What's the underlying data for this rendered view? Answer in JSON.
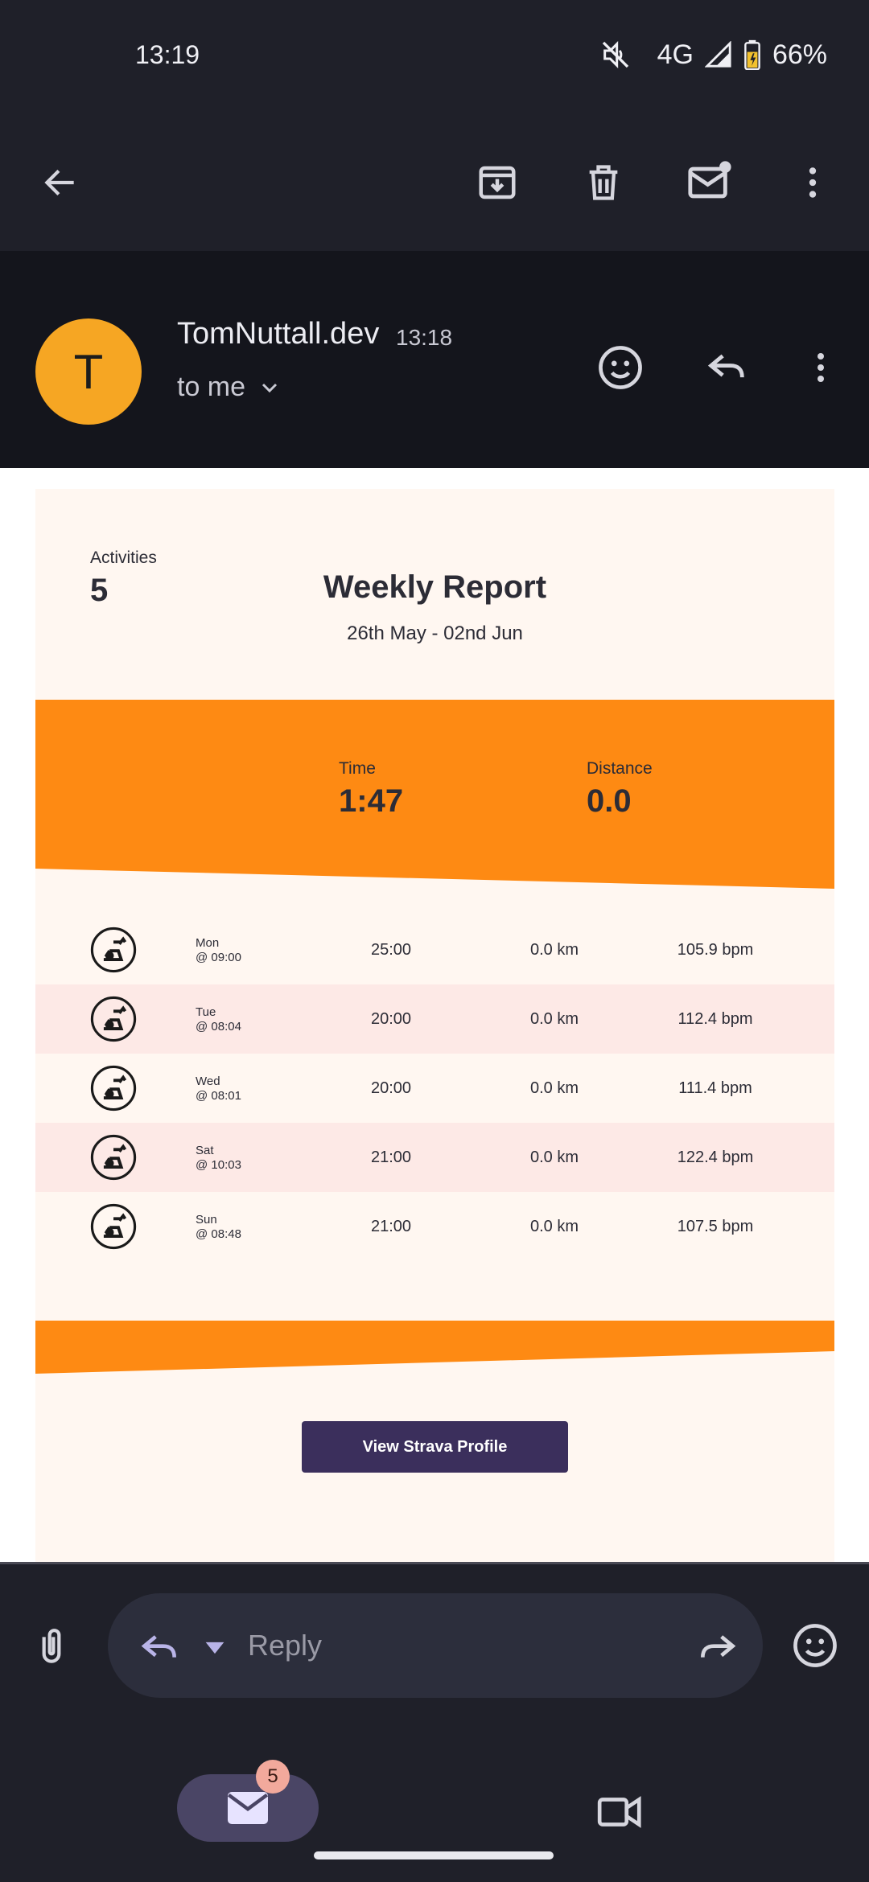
{
  "status_bar": {
    "time": "13:19",
    "network": "4G",
    "battery": "66%",
    "icons": [
      "mute-icon",
      "signal-icon",
      "battery-icon"
    ]
  },
  "toolbar": {
    "icons": [
      "back-arrow-icon",
      "archive-icon",
      "delete-icon",
      "mark-unread-icon",
      "more-vert-icon"
    ]
  },
  "header": {
    "avatar_letter": "T",
    "avatar_color": "#f6a623",
    "sender": "TomNuttall.dev",
    "time": "13:18",
    "recipient": "to me"
  },
  "email": {
    "title": "Weekly Report",
    "date_range": "26th May - 02nd Jun",
    "accent_color": "#fe8a13",
    "stats": [
      {
        "label": "Activities",
        "value": "5"
      },
      {
        "label": "Time",
        "value": "1:47"
      },
      {
        "label": "Distance",
        "value": "0.0"
      }
    ],
    "activities": [
      {
        "day": "Mon",
        "time": "@ 09:00",
        "duration": "25:00",
        "distance": "0.0 km",
        "heart_rate": "105.9 bpm"
      },
      {
        "day": "Tue",
        "time": "@ 08:04",
        "duration": "20:00",
        "distance": "0.0 km",
        "heart_rate": "112.4 bpm"
      },
      {
        "day": "Wed",
        "time": "@ 08:01",
        "duration": "20:00",
        "distance": "0.0 km",
        "heart_rate": "111.4 bpm"
      },
      {
        "day": "Sat",
        "time": "@ 10:03",
        "duration": "21:00",
        "distance": "0.0 km",
        "heart_rate": "122.4 bpm"
      },
      {
        "day": "Sun",
        "time": "@ 08:48",
        "duration": "21:00",
        "distance": "0.0 km",
        "heart_rate": "107.5 bpm"
      }
    ],
    "button_label": "View Strava Profile"
  },
  "reply_bar": {
    "placeholder": "Reply"
  },
  "bottom_nav": {
    "mail_badge": "5"
  }
}
